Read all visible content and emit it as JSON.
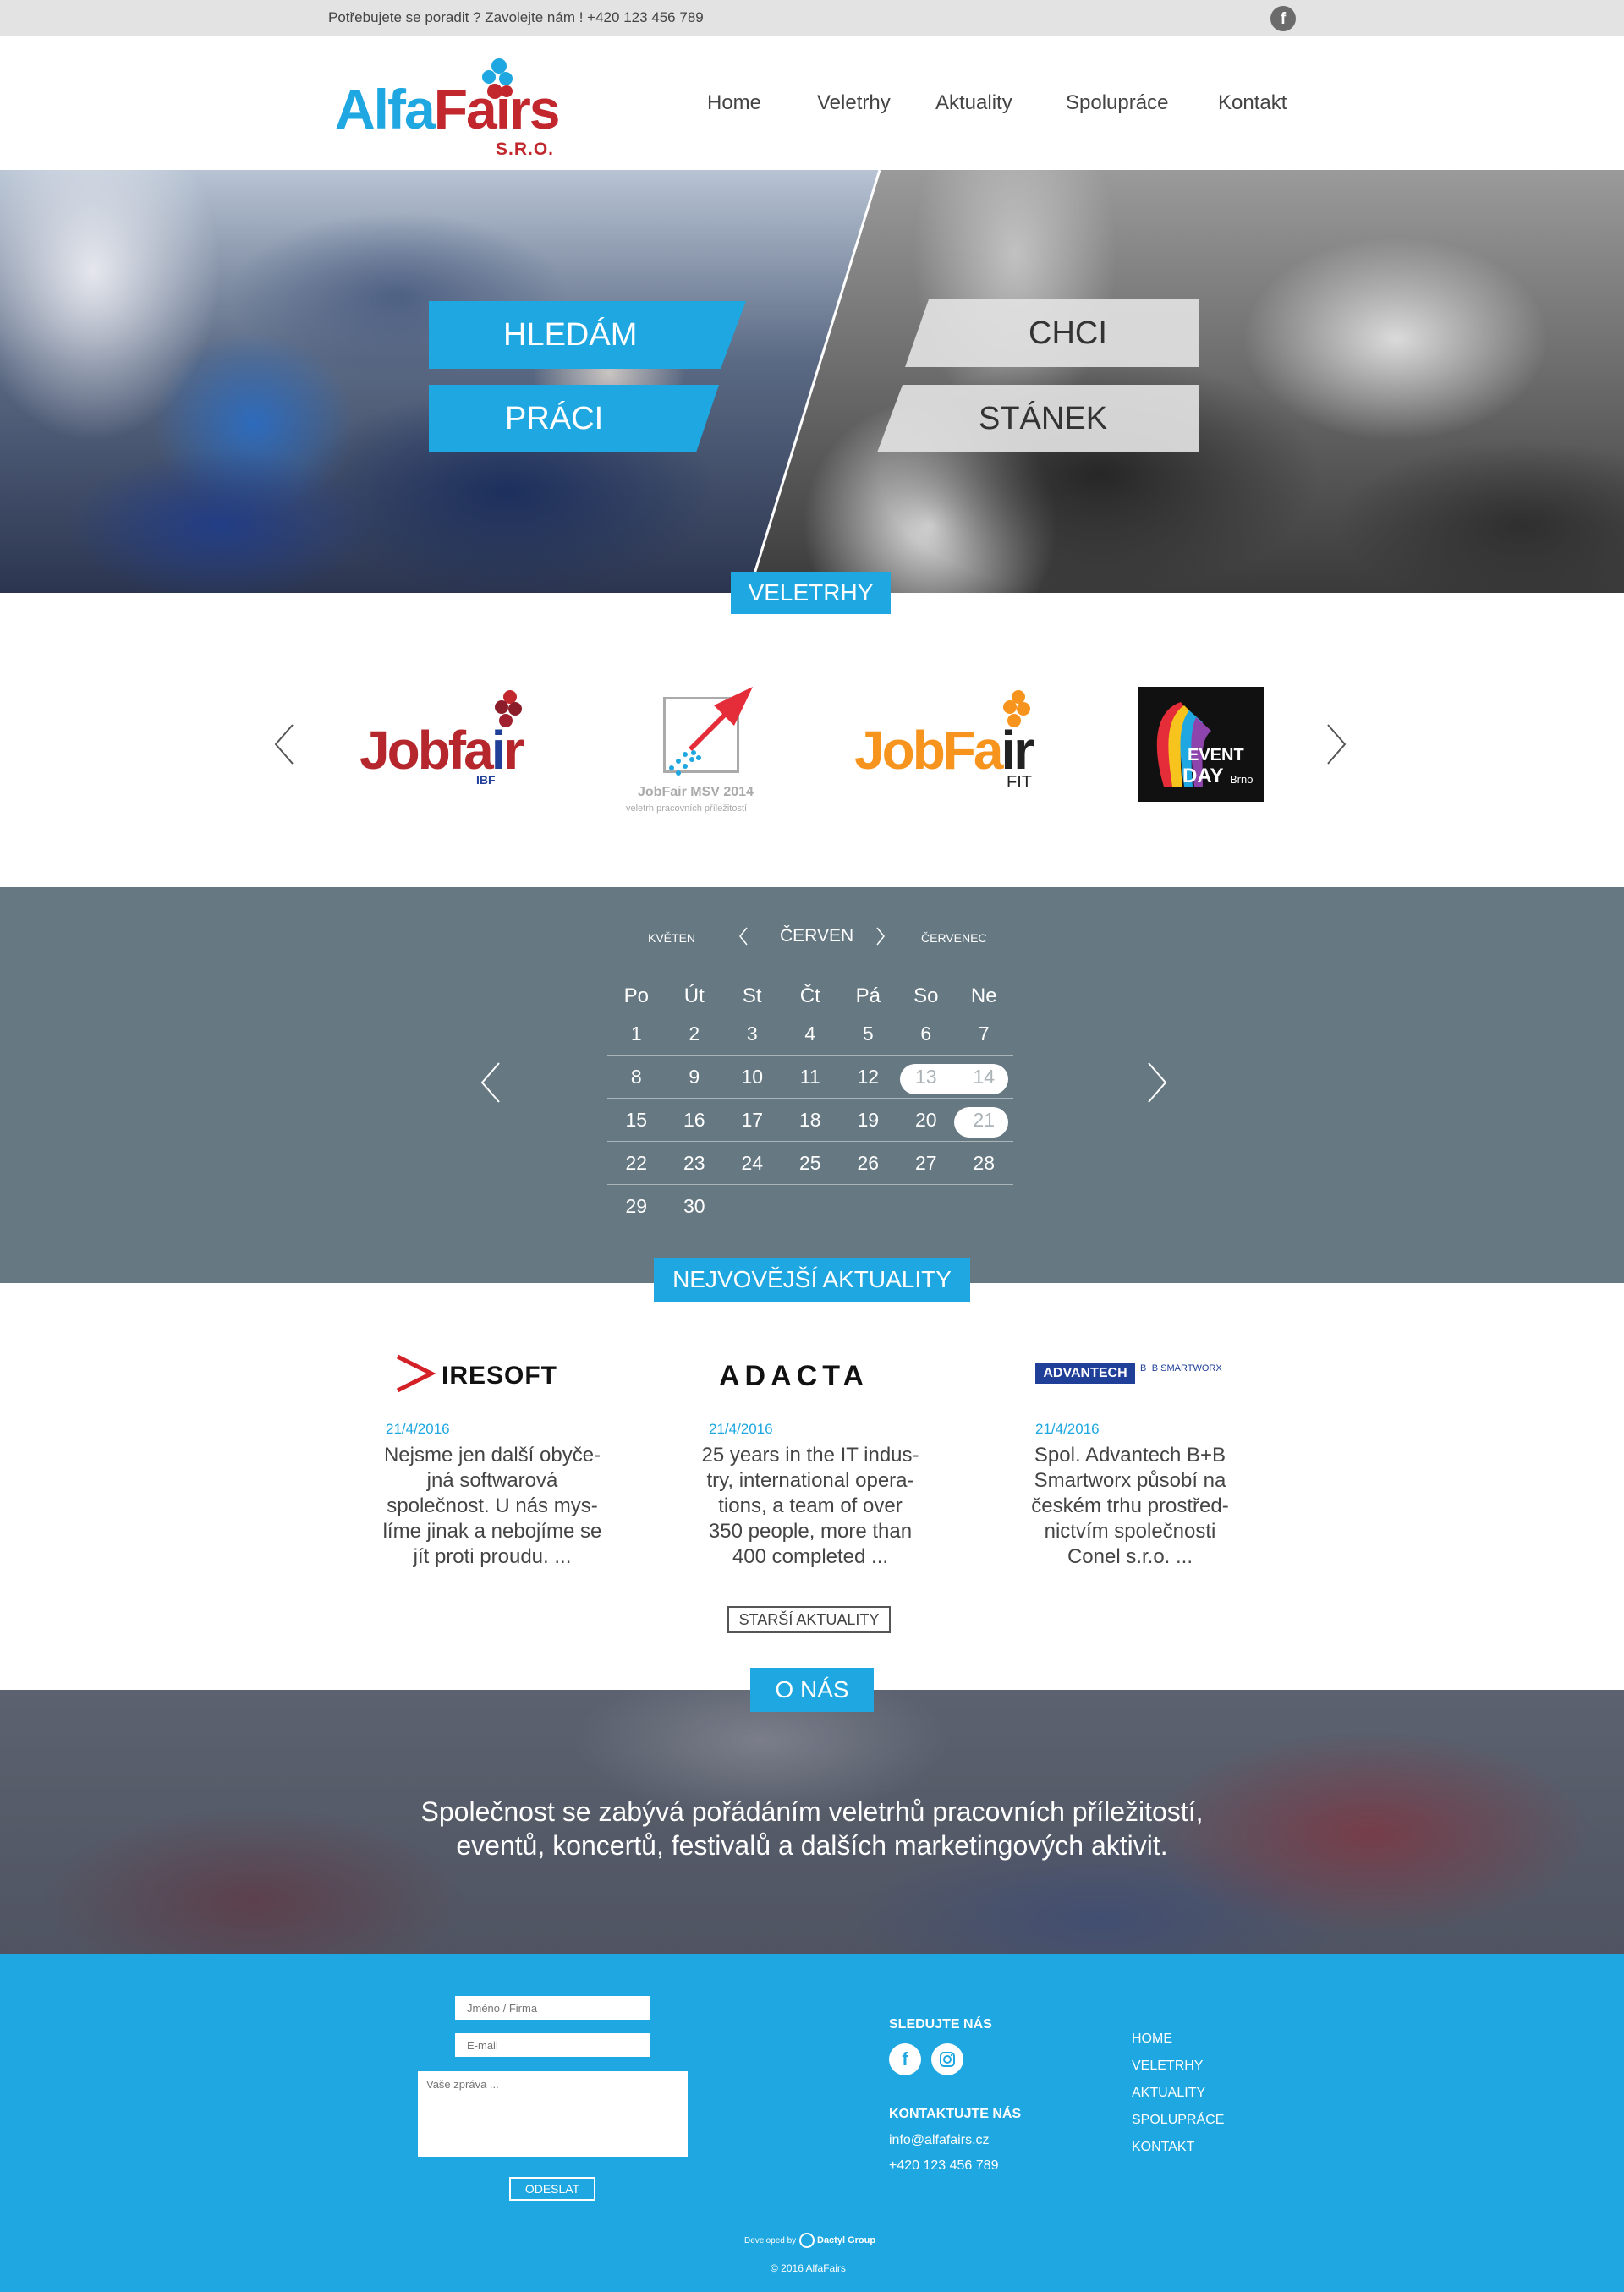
{
  "colors": {
    "accent": "#1ea7e0",
    "brand_red": "#c1272d",
    "calendar_bg": "#667882",
    "topbar_bg": "#e3e3e3"
  },
  "topbar": {
    "contact_text": "Potřebujete se poradit ? Zavolejte nám ! +420 123 456 789",
    "social_icon": "facebook-icon"
  },
  "logo": {
    "text_part1": "Alfa",
    "text_part2": "Fa",
    "text_part3": "i",
    "text_part4": "rs",
    "sub": "S.R.O."
  },
  "nav": {
    "items": [
      "Home",
      "Veletrhy",
      "Aktuality",
      "Spolupráce",
      "Kontakt"
    ]
  },
  "hero": {
    "left_line1": "HLEDÁM",
    "left_line2": "PRÁCI",
    "right_line1": "CHCI",
    "right_line2": "STÁNEK"
  },
  "fairs": {
    "tab_label": "VELETRHY",
    "items": [
      {
        "name": "Jobfair IBF",
        "text": "Jobfa",
        "text2": "r",
        "sub": "IBF"
      },
      {
        "name": "JobFair MSV 2014",
        "text": "JobFair MSV 2014",
        "sub": "veletrh pracovních příležitostí"
      },
      {
        "name": "JobFair FIT",
        "text": "JobFa",
        "text2": "r",
        "sub": "FIT"
      },
      {
        "name": "Event Day Brno",
        "text": "EVENT",
        "text2": "DAY",
        "sub": "Brno"
      }
    ]
  },
  "calendar": {
    "prev_month": "KVĚTEN",
    "current_month": "ČERVEN",
    "next_month": "ČERVENEC",
    "weekdays": [
      "Po",
      "Út",
      "St",
      "Čt",
      "Pá",
      "So",
      "Ne"
    ],
    "weeks": [
      [
        "1",
        "2",
        "3",
        "4",
        "5",
        "6",
        "7"
      ],
      [
        "8",
        "9",
        "10",
        "11",
        "12",
        "13",
        "14"
      ],
      [
        "15",
        "16",
        "17",
        "18",
        "19",
        "20",
        "21"
      ],
      [
        "22",
        "23",
        "24",
        "25",
        "26",
        "27",
        "28"
      ],
      [
        "29",
        "30",
        "",
        "",
        "",
        "",
        ""
      ]
    ],
    "highlighted_days": [
      "13",
      "14",
      "21"
    ]
  },
  "news": {
    "tab_label": "NEJVOVĚJŠÍ AKTUALITY",
    "items": [
      {
        "company": "IRESOFT",
        "date": "21/4/2016",
        "text_lines": [
          "Nejsme jen další obyče-",
          "jná softwarová",
          "společnost. U nás mys-",
          "líme jinak a nebojíme se",
          "jít proti proudu. ..."
        ]
      },
      {
        "company": "ADACTA",
        "date": "21/4/2016",
        "text_lines": [
          "25 years in the IT indus-",
          "try, international opera-",
          "tions, a team of over",
          "350 people, more than",
          "400 completed ..."
        ]
      },
      {
        "company": "ADVANTECH",
        "company_sub": "B+B SMARTWORX",
        "date": "21/4/2016",
        "text_lines": [
          "Spol. Advantech B+B",
          "Smartworx působí na",
          "českém trhu prostřed-",
          "nictvím společnosti",
          "Conel s.r.o. ..."
        ]
      }
    ],
    "older_label": "STARŠÍ AKTUALITY"
  },
  "about": {
    "tab_label": "O NÁS",
    "line1": "Společnost se zabývá pořádáním veletrhů pracovních příležitostí,",
    "line2": "eventů, koncertů, festivalů a dalších marketingových aktivit."
  },
  "footer": {
    "name_placeholder": "Jméno / Firma",
    "email_placeholder": "E-mail",
    "message_placeholder": "Vaše zpráva ...",
    "send_label": "ODESLAT",
    "follow_heading": "SLEDUJTE NÁS",
    "social_icons": [
      "facebook-icon",
      "instagram-icon"
    ],
    "contact_heading": "KONTAKTUJTE NÁS",
    "email": "info@alfafairs.cz",
    "phone": "+420 123 456 789",
    "links": [
      "HOME",
      "VELETRHY",
      "AKTUALITY",
      "SPOLUPRÁCE",
      "KONTAKT"
    ],
    "developed_by": "Developed by",
    "developer": "Dactyl Group",
    "copyright": "© 2016 AlfaFairs"
  }
}
